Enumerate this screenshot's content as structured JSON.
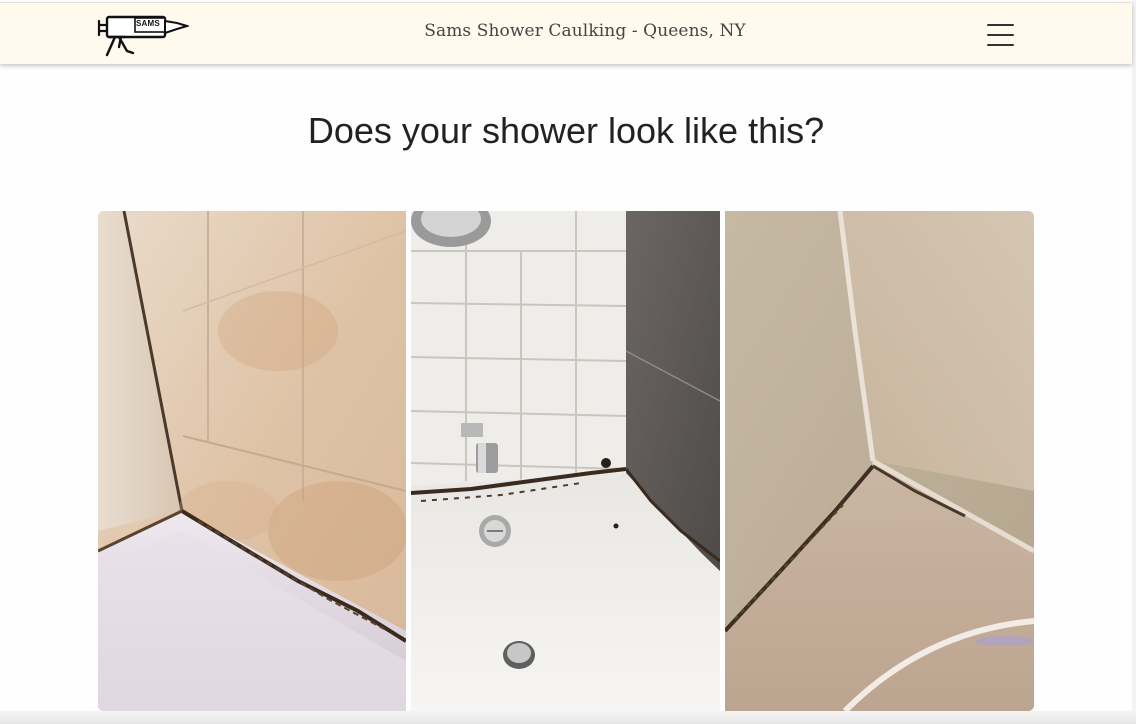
{
  "navbar": {
    "logo_text": "SAMS",
    "title": "Sams Shower Caulking - Queens, NY",
    "menu_icon": "hamburger-menu-icon"
  },
  "hero": {
    "headline": "Does your shower look like this?"
  },
  "gallery": {
    "photos": [
      {
        "subject": "moldy caulk where tiled wall meets bathtub"
      },
      {
        "subject": "moldy caulk around tub corner with faucet and drain"
      },
      {
        "subject": "moldy caulk in corner of tub surround"
      }
    ]
  },
  "colors": {
    "navbar_bg": "#fff9ee",
    "headline": "#222222",
    "title": "#444444"
  }
}
